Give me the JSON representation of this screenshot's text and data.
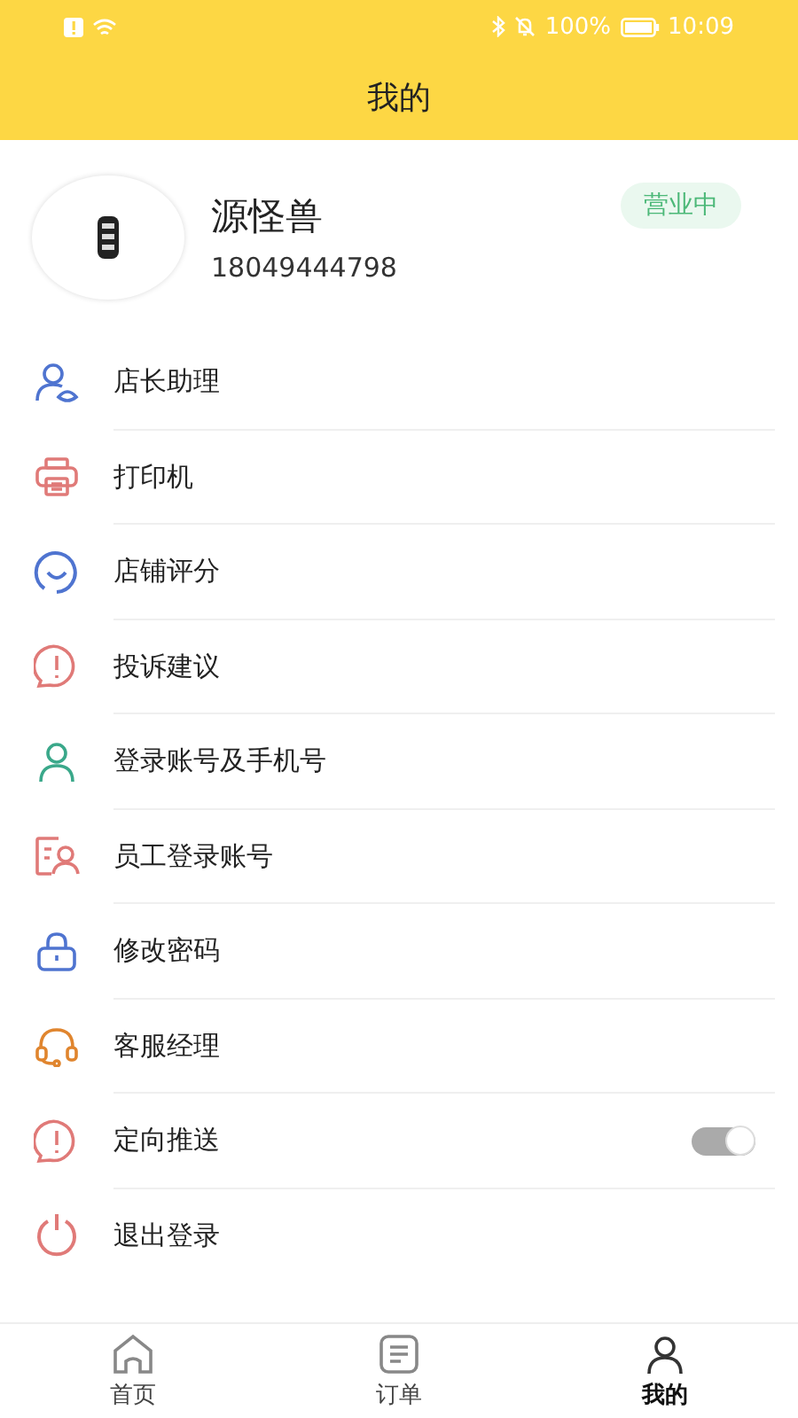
{
  "status_bar": {
    "battery": "100%",
    "time": "10:09"
  },
  "header": {
    "title": "我的"
  },
  "profile": {
    "name": "源怪兽",
    "phone": "18049444798",
    "status": "营业中"
  },
  "menu": [
    {
      "kind": "link",
      "label": "店长助理"
    },
    {
      "kind": "link",
      "label": "打印机"
    },
    {
      "kind": "link",
      "label": "店铺评分"
    },
    {
      "kind": "link",
      "label": "投诉建议"
    },
    {
      "kind": "link",
      "label": "登录账号及手机号"
    },
    {
      "kind": "link",
      "label": "员工登录账号"
    },
    {
      "kind": "link",
      "label": "修改密码"
    },
    {
      "kind": "link",
      "label": "客服经理"
    },
    {
      "kind": "toggle",
      "label": "定向推送",
      "on": true
    },
    {
      "kind": "link",
      "label": "退出登录"
    }
  ],
  "tab_bar": [
    {
      "label": "首页",
      "selected": false
    },
    {
      "label": "订单",
      "selected": false
    },
    {
      "label": "我的",
      "selected": true
    }
  ]
}
